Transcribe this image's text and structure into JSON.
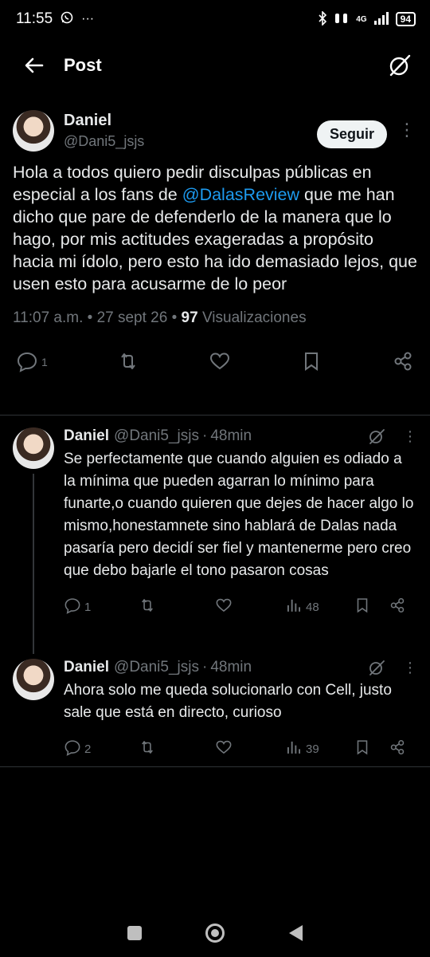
{
  "status_bar": {
    "time": "11:55",
    "left_icons": [
      "whatsapp-icon",
      "more-icon"
    ],
    "network": "4G",
    "battery": "94"
  },
  "header": {
    "title": "Post"
  },
  "main_tweet": {
    "author_name": "Daniel",
    "author_handle": "@Dani5_jsjs",
    "follow_label": "Seguir",
    "text_before": "Hola a todos quiero pedir disculpas públicas en especial a los fans de ",
    "mention": "@DalasReview",
    "text_after": " que me han dicho que pare de defenderlo de la manera que lo hago, por mis actitudes exageradas a propósito hacia mi ídolo, pero esto ha ido demasiado lejos, que usen esto para acusarme de lo peor",
    "timestamp": "11:07 a.m. • 27 sept 26 • ",
    "views_count": "97",
    "views_label": " Visualizaciones",
    "reply_count": "1"
  },
  "replies": [
    {
      "author_name": "Daniel",
      "author_handle": "@Dani5_jsjs",
      "separator": "·",
      "time": "48min",
      "text": "Se perfectamente que cuando alguien es odiado a la mínima que pueden agarran lo mínimo para funarte,o cuando quieren que dejes de hacer algo lo mismo,honestamnete sino hablará de Dalas nada pasaría pero decidí ser fiel y mantenerme pero creo que debo bajarle el tono pasaron cosas",
      "reply_count": "1",
      "views": "48"
    },
    {
      "author_name": "Daniel",
      "author_handle": "@Dani5_jsjs",
      "separator": "·",
      "time": "48min",
      "text": "Ahora solo me queda solucionarlo con Cell, justo sale que está en directo, curioso",
      "reply_count": "2",
      "views": "39"
    }
  ],
  "colors": {
    "background": "#000000",
    "text": "#e7e9ea",
    "muted": "#71767b",
    "link": "#1d9bf0",
    "divider": "#2f3336"
  }
}
